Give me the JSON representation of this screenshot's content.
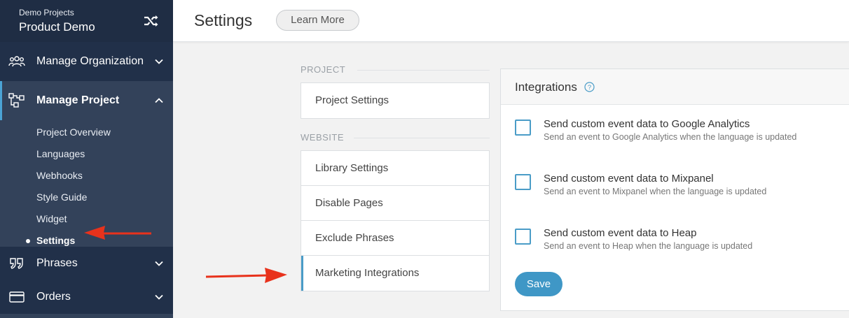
{
  "sidebar": {
    "project_group": "Demo Projects",
    "project_name": "Product Demo",
    "manage_org": "Manage Organization",
    "manage_project": "Manage Project",
    "sub_items": [
      "Project Overview",
      "Languages",
      "Webhooks",
      "Style Guide",
      "Widget",
      "Settings"
    ],
    "phrases": "Phrases",
    "orders": "Orders"
  },
  "header": {
    "title": "Settings",
    "learn_more": "Learn More"
  },
  "menu": {
    "project_label": "PROJECT",
    "project_items": [
      "Project Settings"
    ],
    "website_label": "WEBSITE",
    "website_items": [
      "Library Settings",
      "Disable Pages",
      "Exclude Phrases",
      "Marketing Integrations"
    ]
  },
  "panel": {
    "title": "Integrations",
    "options": [
      {
        "label": "Send custom event data to Google Analytics",
        "desc": "Send an event to Google Analytics when the language is updated"
      },
      {
        "label": "Send custom event data to Mixpanel",
        "desc": "Send an event to Mixpanel when the language is updated"
      },
      {
        "label": "Send custom event data to Heap",
        "desc": "Send an event to Heap when the language is updated"
      }
    ],
    "save": "Save"
  },
  "colors": {
    "sidebar_bg": "#33425a",
    "sidebar_dark": "#1f2d44",
    "accent": "#3f97c6",
    "arrow": "#e8321c"
  }
}
